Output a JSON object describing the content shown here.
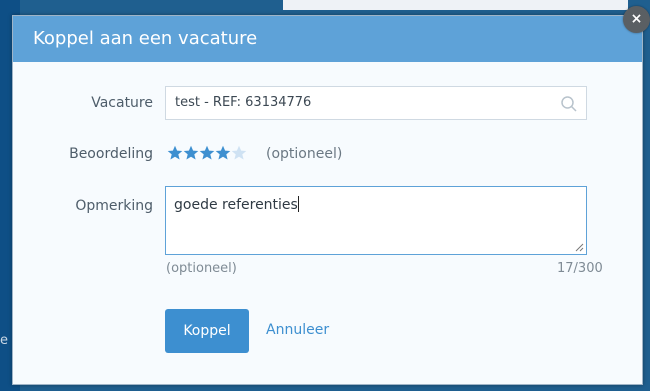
{
  "modal": {
    "title": "Koppel aan een vacature",
    "close_symbol": "×"
  },
  "form": {
    "vacature_label": "Vacature",
    "vacature_value": "test - REF: 63134776",
    "beoordeling_label": "Beoordeling",
    "rating": 4,
    "rating_max": 5,
    "rating_hint": "(optioneel)",
    "opmerking_label": "Opmerking",
    "opmerking_value": "goede referenties",
    "opmerking_hint": "(optioneel)",
    "char_count": "17/300"
  },
  "actions": {
    "primary_label": "Koppel",
    "cancel_label": "Annuleer"
  },
  "background": {
    "left_text": "e"
  },
  "colors": {
    "header": "#5ea2d8",
    "primary": "#3d8fd0",
    "star_filled": "#3d8fd0",
    "star_empty": "#cfe2f3"
  },
  "icons": {
    "search": "search-icon",
    "close": "close-icon",
    "resize": "resize-handle-icon",
    "star": "star-icon"
  }
}
